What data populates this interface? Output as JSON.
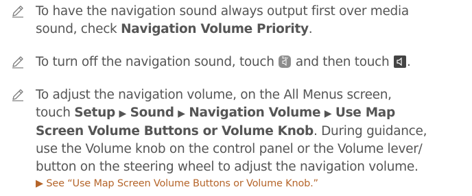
{
  "notes": [
    {
      "line1": "To have the navigation sound always output first over media",
      "line2_pre": "sound, check ",
      "line2_bold": "Navigation Volume Priority",
      "line2_post": "."
    },
    {
      "pre": "To turn off the navigation sound, touch ",
      "nav_icon_text": "Nav",
      "mid": " and then touch ",
      "post": "."
    },
    {
      "line1": "To adjust the navigation volume, on the All Menus screen,",
      "line2_pre": "touch ",
      "setup": "Setup",
      "sound": "Sound",
      "nav_volume": "Navigation Volume",
      "line2_tail": "Use Map",
      "line3_bold": "Screen Volume Buttons or Volume Knob",
      "line3_post": ". During guidance,",
      "line4": "use the Volume knob on the control panel or the Volume lever/",
      "line5": "button on the steering wheel to adjust the navigation volume.",
      "link": "See “Use Map Screen Volume Buttons or Volume Knob.”"
    }
  ],
  "arrow_glyph": "▶"
}
